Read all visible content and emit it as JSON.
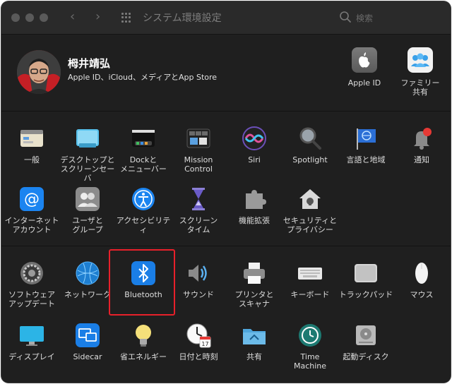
{
  "window": {
    "title": "システム環境設定",
    "search_placeholder": "検索"
  },
  "user": {
    "name": "栂井靖弘",
    "subtitle": "Apple ID、iCloud、メディアとApp Store"
  },
  "top_panes": [
    {
      "label": "Apple ID"
    },
    {
      "label": "ファミリー\n共有"
    }
  ],
  "section1": [
    {
      "label": "一般"
    },
    {
      "label": "デスクトップと\nスクリーンセーバ"
    },
    {
      "label": "Dockと\nメニューバー"
    },
    {
      "label": "Mission\nControl"
    },
    {
      "label": "Siri"
    },
    {
      "label": "Spotlight"
    },
    {
      "label": "言語と地域"
    },
    {
      "label": "通知"
    },
    {
      "label": "インターネット\nアカウント"
    },
    {
      "label": "ユーザと\nグループ"
    },
    {
      "label": "アクセシビリティ"
    },
    {
      "label": "スクリーン\nタイム"
    },
    {
      "label": "機能拡張"
    },
    {
      "label": "セキュリティと\nプライバシー"
    }
  ],
  "section2": [
    {
      "label": "ソフトウェア\nアップデート"
    },
    {
      "label": "ネットワーク"
    },
    {
      "label": "Bluetooth"
    },
    {
      "label": "サウンド"
    },
    {
      "label": "プリンタと\nスキャナ"
    },
    {
      "label": "キーボード"
    },
    {
      "label": "トラックパッド"
    },
    {
      "label": "マウス"
    },
    {
      "label": "ディスプレイ"
    },
    {
      "label": "Sidecar"
    },
    {
      "label": "省エネルギー"
    },
    {
      "label": "日付と時刻"
    },
    {
      "label": "共有"
    },
    {
      "label": "Time\nMachine"
    },
    {
      "label": "起動ディスク"
    }
  ],
  "icons": {
    "calendar_day": "17"
  },
  "colors": {
    "highlight": "#e8202a",
    "accent": "#1a7ee6"
  }
}
